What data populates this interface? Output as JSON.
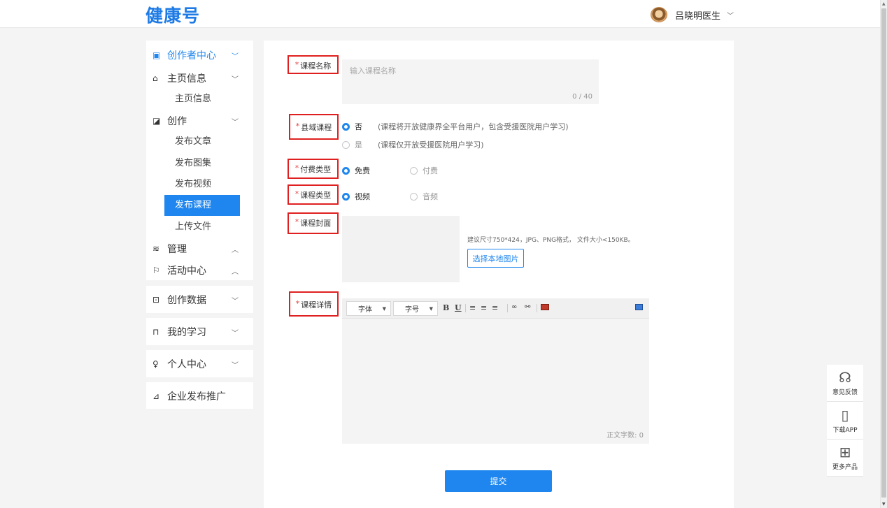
{
  "header": {
    "logo": "健康号",
    "user_name": "吕晓明医生"
  },
  "sidebar": {
    "creator_center": "创作者中心",
    "home_info": "主页信息",
    "home_info_sub": "主页信息",
    "creation": "创作",
    "creation_items": [
      "发布文章",
      "发布图集",
      "发布视频",
      "发布课程",
      "上传文件"
    ],
    "manage": "管理",
    "activity_center": "活动中心",
    "creation_data": "创作数据",
    "my_learning": "我的学习",
    "personal_center": "个人中心",
    "enterprise_promo": "企业发布推广"
  },
  "form": {
    "name_label": "课程名称",
    "name_placeholder": "输入课程名称",
    "name_counter": "0 / 40",
    "county_label": "县域课程",
    "county_no": "否",
    "county_no_hint": "(课程将开放健康界全平台用户，包含受援医院用户学习)",
    "county_yes": "是",
    "county_yes_hint": "(课程仅开放受援医院用户学习)",
    "fee_label": "付费类型",
    "fee_free": "免费",
    "fee_paid": "付费",
    "type_label": "课程类型",
    "type_video": "视频",
    "type_audio": "音频",
    "cover_label": "课程封面",
    "cover_hint": "建议尺寸750*424，JPG、PNG格式， 文件大小<150KB。",
    "cover_button": "选择本地图片",
    "detail_label": "课程详情",
    "font_select": "字体",
    "size_select": "字号",
    "word_count": "正文字数: 0",
    "submit": "提交"
  },
  "float_panel": {
    "feedback": "意见反馈",
    "download": "下载APP",
    "more": "更多产品"
  },
  "colors": {
    "accent": "#1e86ee",
    "highlight_border": "#e02020"
  }
}
